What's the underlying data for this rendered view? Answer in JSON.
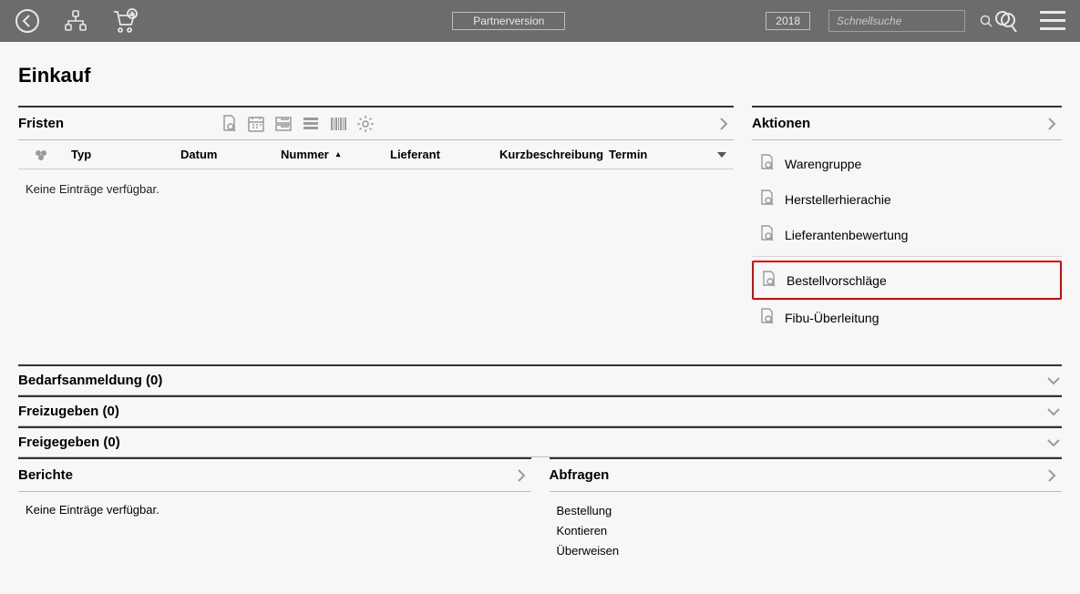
{
  "header": {
    "version_label": "Partnerversion",
    "year": "2018",
    "search_placeholder": "Schnellsuche"
  },
  "page_title": "Einkauf",
  "panels": {
    "fristen": {
      "title": "Fristen",
      "columns": {
        "typ": "Typ",
        "datum": "Datum",
        "nummer": "Nummer",
        "lieferant": "Lieferant",
        "kurz": "Kurzbeschreibung",
        "termin": "Termin"
      },
      "empty_text": "Keine Einträge verfügbar."
    },
    "aktionen": {
      "title": "Aktionen",
      "items_group1": [
        "Warengruppe",
        "Herstellerhierachie",
        "Lieferantenbewertung"
      ],
      "items_group2": [
        "Bestellvorschläge",
        "Fibu-Überleitung"
      ],
      "highlight_index_group2": 0
    }
  },
  "sections": {
    "bedarf": "Bedarfsanmeldung (0)",
    "freizugeben": "Freizugeben (0)",
    "freigegeben": "Freigegeben (0)"
  },
  "berichte": {
    "title": "Berichte",
    "empty_text": "Keine Einträge verfügbar."
  },
  "abfragen": {
    "title": "Abfragen",
    "items": [
      "Bestellung",
      "Kontieren",
      "Überweisen"
    ]
  }
}
